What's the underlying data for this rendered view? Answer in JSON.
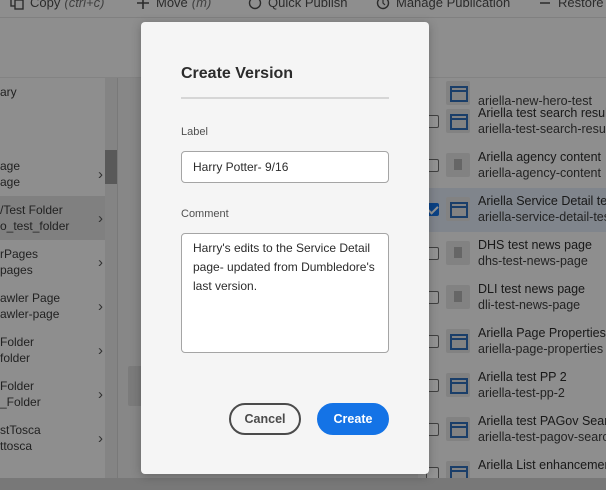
{
  "toolbar": {
    "items": [
      {
        "label": "Copy",
        "hint": "(ctrl+c)",
        "icon": "copy-icon"
      },
      {
        "label": "Move",
        "hint": "(m)",
        "icon": "move-icon"
      },
      {
        "label": "Quick Publish",
        "icon": "publish-icon"
      },
      {
        "label": "Manage Publication",
        "icon": "manage-publication-icon"
      },
      {
        "label": "Restore",
        "icon": "restore-icon"
      }
    ]
  },
  "left_column": {
    "rows": [
      {
        "line1": "ary",
        "line2": ""
      },
      {
        "line1": "age",
        "line2": "age"
      },
      {
        "line1": "/Test Folder",
        "line2": "o_test_folder"
      },
      {
        "line1": "rPages",
        "line2": "pages"
      },
      {
        "line1": "awler Page",
        "line2": "awler-page"
      },
      {
        "line1": "Folder",
        "line2": "folder"
      },
      {
        "line1": "Folder",
        "line2": "_Folder"
      },
      {
        "line1": "stTosca",
        "line2": "ttosca"
      }
    ]
  },
  "right_column": {
    "rows": [
      {
        "title": "",
        "name": "ariella-new-hero-test"
      },
      {
        "title": "Ariella test search results",
        "name": "ariella-test-search-results"
      },
      {
        "title": "Ariella agency content",
        "name": "ariella-agency-content"
      },
      {
        "title": "Ariella Service Detail test",
        "name": "ariella-service-detail-test"
      },
      {
        "title": "DHS test news page",
        "name": "dhs-test-news-page"
      },
      {
        "title": "DLI test news page",
        "name": "dli-test-news-page"
      },
      {
        "title": "Ariella Page Properties",
        "name": "ariella-page-properties"
      },
      {
        "title": "Ariella test PP 2",
        "name": "ariella-test-pp-2"
      },
      {
        "title": "Ariella test PAGov Search",
        "name": "ariella-test-pagov-search"
      },
      {
        "title": "Ariella List enhancement",
        "name": ""
      }
    ]
  },
  "dialog": {
    "title": "Create Version",
    "label_field": {
      "label": "Label",
      "value": "Harry Potter- 9/16"
    },
    "comment_field": {
      "label": "Comment",
      "value": "Harry's edits to the Service Detail page- updated from Dumbledore's last version."
    },
    "cancel_label": "Cancel",
    "create_label": "Create"
  },
  "colors": {
    "accent": "#1473e6",
    "dialog_bg": "#f5f5f5",
    "overlay": "rgba(0,0,0,0.42)"
  }
}
